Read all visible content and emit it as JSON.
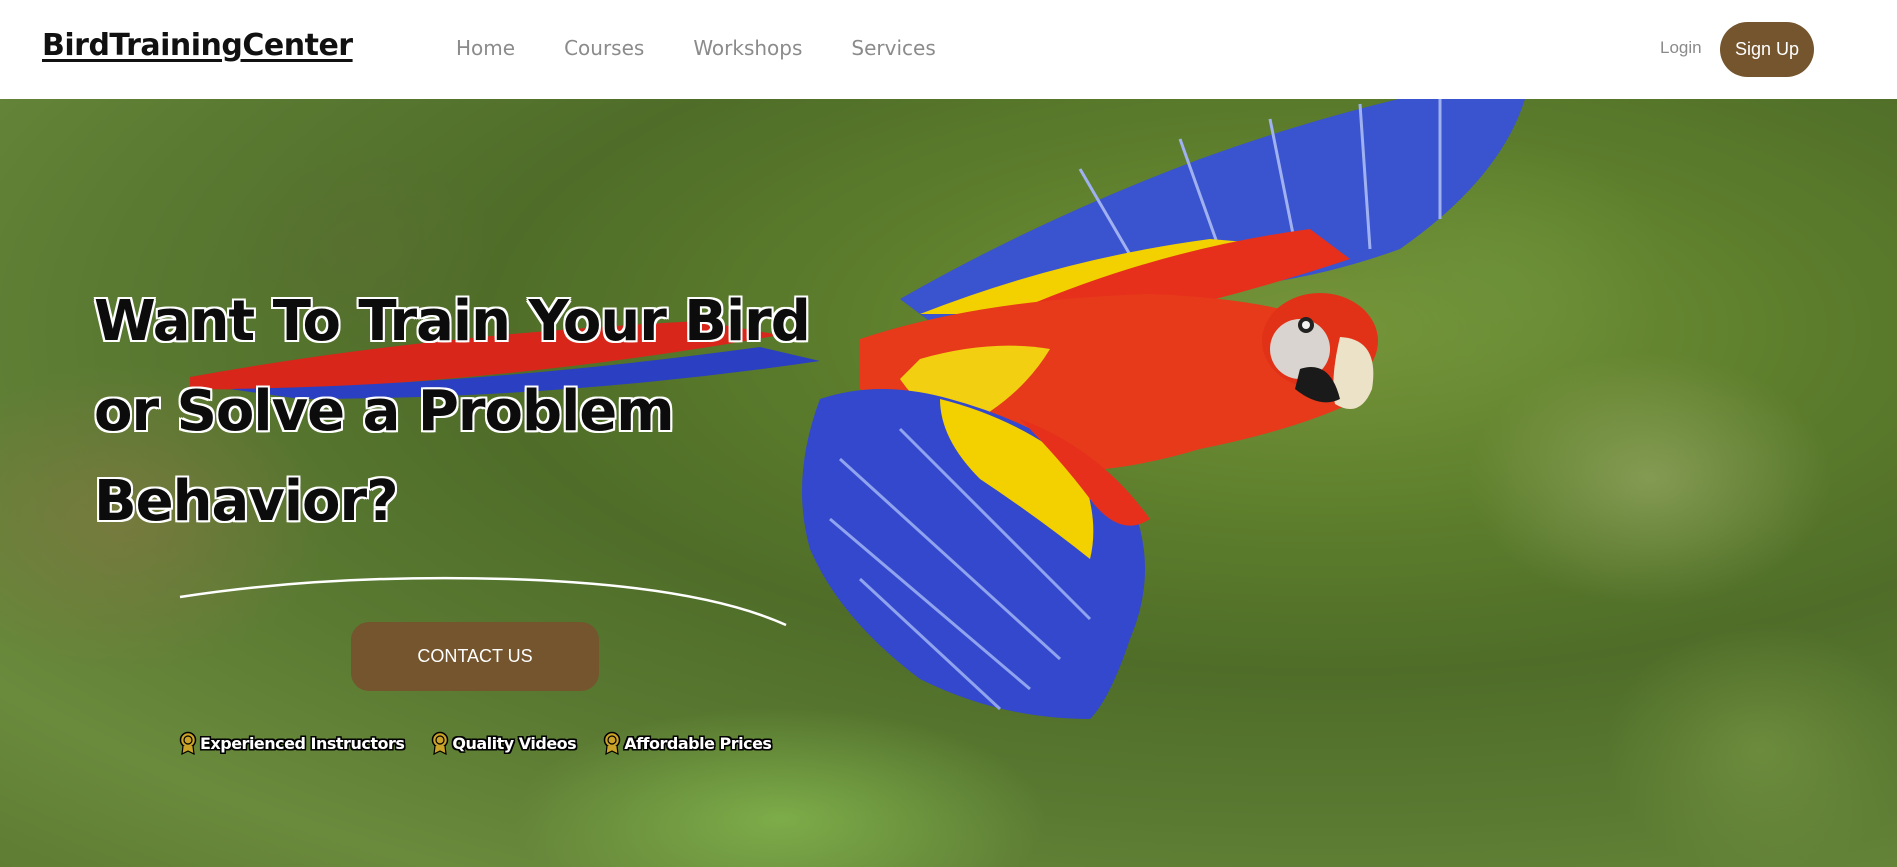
{
  "brand": {
    "logo_text": "BirdTrainingCenter"
  },
  "nav": {
    "links": [
      "Home",
      "Courses",
      "Workshops",
      "Services"
    ],
    "login_label": "Login",
    "signup_label": "Sign Up"
  },
  "hero": {
    "headline_line1": "Want To Train Your Bird",
    "headline_line2": "or Solve a Problem",
    "headline_line3": "Behavior?",
    "contact_label": "CONTACT US",
    "features": [
      {
        "label": "Experienced Instructors",
        "icon": "award-badge-icon"
      },
      {
        "label": "Quality Videos",
        "icon": "award-badge-icon"
      },
      {
        "label": "Affordable Prices",
        "icon": "award-badge-icon"
      }
    ]
  },
  "colors": {
    "accent_brown": "#74552e",
    "nav_text": "#8b8b8b",
    "nav_background": "#ffffff"
  }
}
